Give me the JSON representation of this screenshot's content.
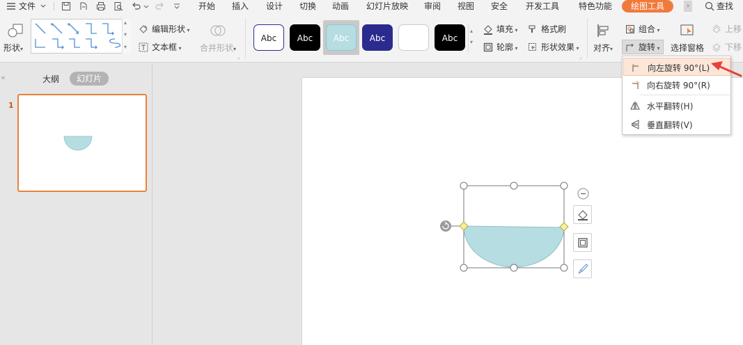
{
  "menu": {
    "file": "文件",
    "tabs": [
      "开始",
      "插入",
      "设计",
      "切换",
      "动画",
      "幻灯片放映",
      "审阅",
      "视图",
      "安全",
      "开发工具",
      "特色功能"
    ],
    "active_tab": "绘图工具",
    "search": "查找"
  },
  "ribbon": {
    "shape": "形状",
    "edit_shape": "编辑形状",
    "textbox": "文本框",
    "merge_shape": "合并形状",
    "style_samples": [
      "Abc",
      "Abc",
      "Abc",
      "Abc",
      "",
      "Abc"
    ],
    "fill": "填充",
    "format_painter": "格式刷",
    "outline": "轮廓",
    "shape_effects": "形状效果",
    "align": "对齐",
    "group": "组合",
    "rotate": "旋转",
    "selection_pane": "选择窗格",
    "bring_forward": "上移",
    "send_backward": "下移"
  },
  "left_pane": {
    "tab_outline": "大纲",
    "tab_slides": "幻灯片",
    "slide_number": "1"
  },
  "rotate_menu": {
    "items": [
      "向左旋转 90°(L)",
      "向右旋转 90°(R)",
      "水平翻转(H)",
      "垂直翻转(V)"
    ]
  },
  "colors": {
    "accent": "#f07a3c",
    "shape_fill": "#b6dde2",
    "arrow": "#e8403a",
    "style_dark_blue": "#2b2b8f"
  }
}
